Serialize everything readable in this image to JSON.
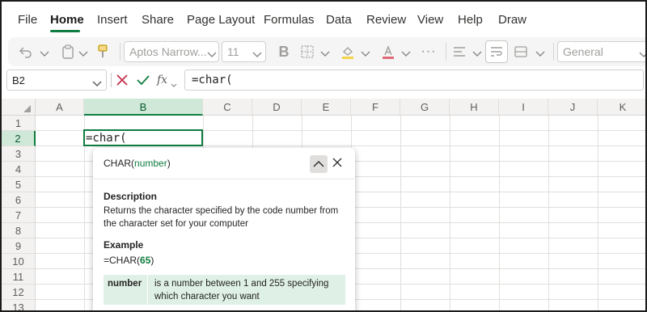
{
  "menu": {
    "items": [
      {
        "label": "File"
      },
      {
        "label": "Home"
      },
      {
        "label": "Insert"
      },
      {
        "label": "Share"
      },
      {
        "label": "Page Layout"
      },
      {
        "label": "Formulas"
      },
      {
        "label": "Data"
      },
      {
        "label": "Review"
      },
      {
        "label": "View"
      },
      {
        "label": "Help"
      },
      {
        "label": "Draw"
      }
    ],
    "active": "Home"
  },
  "ribbon": {
    "font_name": "Aptos Narrow...",
    "font_size": "11",
    "number_format": "General",
    "icons": [
      "undo-icon",
      "clipboard-icon",
      "format-painter-icon",
      "bold-icon",
      "borders-icon",
      "fill-color-icon",
      "font-color-icon",
      "more-icon",
      "align-icon",
      "wrap-text-icon",
      "merge-icon"
    ]
  },
  "formula_bar": {
    "name_box": "B2",
    "fx_label": "fx",
    "formula": "=char("
  },
  "grid": {
    "columns": [
      "A",
      "B",
      "C",
      "D",
      "E",
      "F",
      "G",
      "H",
      "I",
      "J",
      "K"
    ],
    "rows": [
      "1",
      "2",
      "3",
      "4",
      "5",
      "6",
      "7",
      "8",
      "9",
      "10",
      "11",
      "12",
      "13"
    ],
    "selected_column": "B",
    "selected_row": "2",
    "active_cell_value": "=char("
  },
  "tooltip": {
    "func_name": "CHAR",
    "func_arg": "number",
    "description_heading": "Description",
    "description": "Returns the character specified by the code number from the character set for your computer",
    "example_heading": "Example",
    "example_func": "=CHAR(",
    "example_arg": "65",
    "example_close": ")",
    "argument_name": "number",
    "argument_desc": "is a number between 1 and 255 specifying which character you want"
  },
  "colors": {
    "accent": "#107c41",
    "selected_header_bg": "#cfe8d8",
    "argument_bg": "#dff0e6",
    "cancel_red": "#c4314b"
  }
}
